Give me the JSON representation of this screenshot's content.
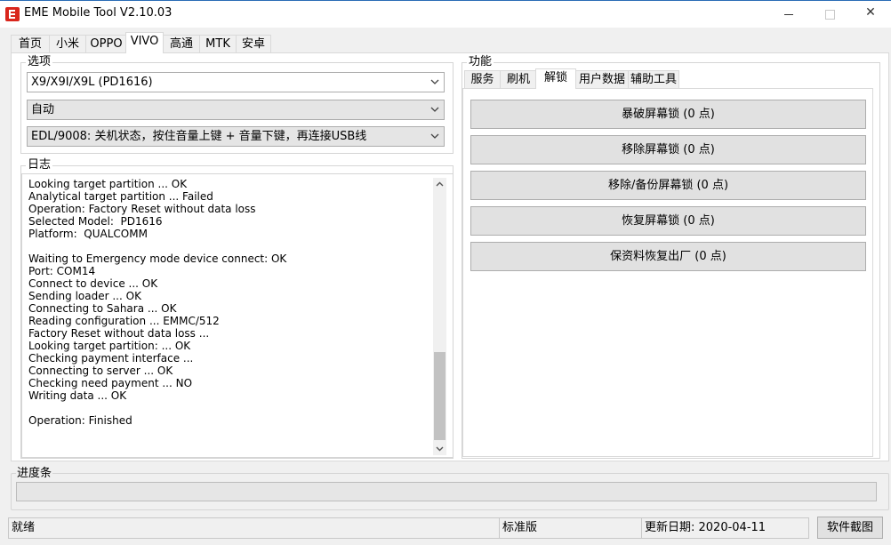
{
  "window": {
    "title": "EME Mobile Tool V2.10.03",
    "controls": {
      "minimize": "—",
      "maximize": "☐",
      "close": "✕"
    }
  },
  "tabs": [
    {
      "label": "首页",
      "active": false
    },
    {
      "label": "小米",
      "active": false
    },
    {
      "label": "OPPO",
      "active": false
    },
    {
      "label": "VIVO",
      "active": true
    },
    {
      "label": "高通",
      "active": false
    },
    {
      "label": "MTK",
      "active": false
    },
    {
      "label": "安卓",
      "active": false
    }
  ],
  "options": {
    "label": "选项",
    "model_select": "X9/X9I/X9L (PD1616)",
    "mode_select": "自动",
    "connection_select": "EDL/9008: 关机状态，按住音量上键 + 音量下键，再连接USB线"
  },
  "log": {
    "label": "日志",
    "lines": [
      "Looking target partition ... OK",
      "Analytical target partition ... Failed",
      "Operation: Factory Reset without data loss",
      "Selected Model:  PD1616",
      "Platform:  QUALCOMM",
      "",
      "Waiting to Emergency mode device connect: OK",
      "Port: COM14",
      "Connect to device ... OK",
      "Sending loader ... OK",
      "Connecting to Sahara ... OK",
      "Reading configuration ... EMMC/512",
      "Factory Reset without data loss ...",
      "Looking target partition: ... OK",
      "Checking payment interface ...",
      "Connecting to server ... OK",
      "Checking need payment ... NO",
      "Writing data ... OK",
      "",
      "Operation: Finished"
    ]
  },
  "functions": {
    "label": "功能",
    "tabs": [
      {
        "label": "服务",
        "active": false
      },
      {
        "label": "刷机",
        "active": false
      },
      {
        "label": "解锁",
        "active": true
      },
      {
        "label": "用户数据",
        "active": false
      },
      {
        "label": "辅助工具",
        "active": false
      }
    ],
    "buttons": [
      "暴破屏幕锁 (0 点)",
      "移除屏幕锁 (0 点)",
      "移除/备份屏幕锁 (0 点)",
      "恢复屏幕锁 (0 点)",
      "保资料恢复出厂 (0 点)"
    ]
  },
  "progress": {
    "label": "进度条",
    "value": 0
  },
  "status": {
    "state": "就绪",
    "edition": "标准版",
    "update_date": "更新日期:  2020-04-11"
  },
  "screenshot_button": "软件截图",
  "colors": {
    "accent_border": "#2a6cb5",
    "progress_fill": "#06b025",
    "app_icon": "#d9261c"
  }
}
